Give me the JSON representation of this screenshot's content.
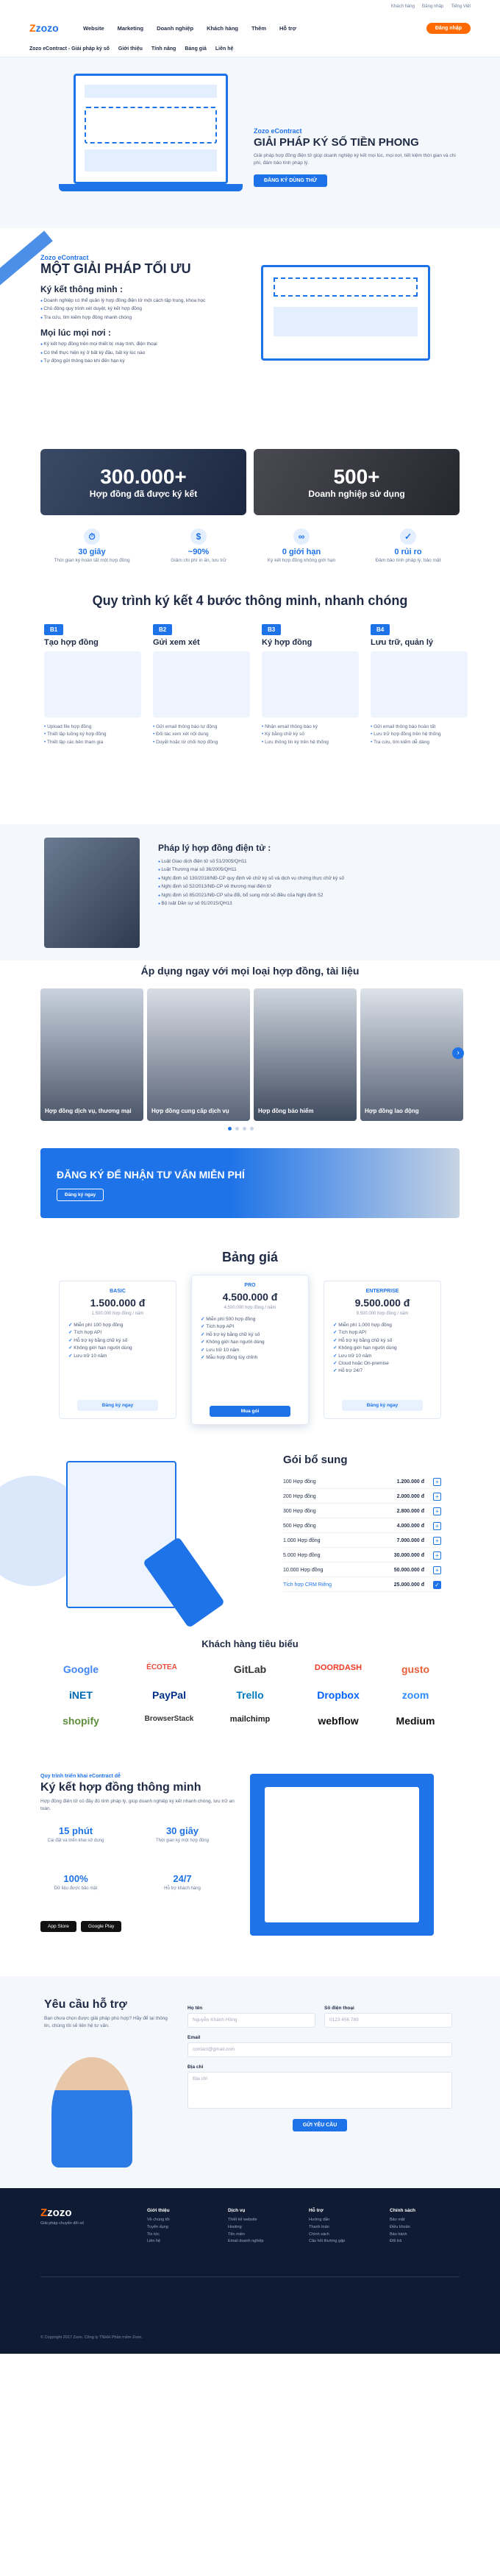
{
  "topbar": {
    "links": [
      "Khách hàng",
      "Đăng nhập",
      "Tiếng Việt"
    ]
  },
  "header": {
    "logo": "zozo",
    "menu": [
      "Website",
      "Marketing",
      "Doanh nghiệp",
      "Khách hàng",
      "Thêm",
      "Hỗ trợ"
    ],
    "cta": "Đăng nhập"
  },
  "subnav": [
    "Zozo eContract - Giải pháp ký số",
    "Giới thiệu",
    "Tính năng",
    "Bảng giá",
    "Liên hệ"
  ],
  "hero": {
    "eyebrow": "Zozo eContract",
    "title": "GIẢI PHÁP KÝ SỐ TIỀN PHONG",
    "desc": "Giải pháp hợp đồng điện tử giúp doanh nghiệp ký kết mọi lúc, mọi nơi, tiết kiệm thời gian và chi phí, đảm bảo tính pháp lý.",
    "button": "Đăng ký dùng thử"
  },
  "solution": {
    "eyebrow": "Zozo eContract",
    "title": "MỘT GIẢI PHÁP TỐI ƯU",
    "items": [
      {
        "title": "Ký kết thông minh :",
        "bullets": [
          "Doanh nghiệp có thể quản lý hợp đồng điện tử một cách tập trung, khoa học",
          "Chủ động quy trình xét duyệt, ký kết hợp đồng",
          "Tra cứu, tìm kiếm hợp đồng nhanh chóng"
        ]
      },
      {
        "title": "Mọi lúc mọi nơi :",
        "bullets": [
          "Ký kết hợp đồng trên mọi thiết bị: máy tính, điện thoại",
          "Có thể thực hiện ký ở bất kỳ đâu, bất kỳ lúc nào",
          "Tự động gửi thông báo khi đến hạn ký"
        ]
      }
    ]
  },
  "stats": [
    {
      "value": "300.000+",
      "label": "Hợp đồng đã được ký kết"
    },
    {
      "value": "500+",
      "label": "Doanh nghiệp sử dụng"
    }
  ],
  "features": [
    {
      "value": "30 giây",
      "desc": "Thời gian ký hoàn tất một hợp đồng"
    },
    {
      "value": "~90%",
      "desc": "Giảm chi phí in ấn, lưu trữ"
    },
    {
      "value": "0 giới hạn",
      "desc": "Ký kết hợp đồng không giới hạn"
    },
    {
      "value": "0 rủi ro",
      "desc": "Đảm bảo tính pháp lý, bảo mật"
    }
  ],
  "process": {
    "title": "Quy trình ký kết 4 bước thông minh, nhanh chóng",
    "steps": [
      {
        "badge": "B1",
        "title": "Tạo hợp đồng",
        "bullets": [
          "Upload file hợp đồng",
          "Thiết lập luồng ký hợp đồng",
          "Thiết lập các bên tham gia"
        ]
      },
      {
        "badge": "B2",
        "title": "Gửi xem xét",
        "bullets": [
          "Gửi email thông báo tự động",
          "Đối tác xem xét nội dung",
          "Duyệt hoặc từ chối hợp đồng"
        ]
      },
      {
        "badge": "B3",
        "title": "Ký hợp đồng",
        "bullets": [
          "Nhận email thông báo ký",
          "Ký bằng chữ ký số",
          "Lưu thông tin ký trên hệ thống"
        ]
      },
      {
        "badge": "B4",
        "title": "Lưu trữ, quản lý",
        "bullets": [
          "Gửi email thông báo hoàn tất",
          "Lưu trữ hợp đồng trên hệ thống",
          "Tra cứu, tìm kiếm dễ dàng"
        ]
      }
    ]
  },
  "legal": {
    "title": "Pháp lý hợp đồng điện tử :",
    "bullets": [
      "Luật Giao dịch điện tử số 51/2005/QH11",
      "Luật Thương mại số 36/2005/QH11",
      "Nghị định số 130/2018/NĐ-CP quy định về chữ ký số và dịch vụ chứng thực chữ ký số",
      "Nghị định số 52/2013/NĐ-CP về thương mại điện tử",
      "Nghị định số 85/2021/NĐ-CP sửa đổi, bổ sung một số điều của Nghị định 52",
      "Bộ luật Dân sự số 91/2015/QH13"
    ]
  },
  "apply": {
    "title": "Áp dụng ngay với mọi loại hợp đồng, tài liệu",
    "cards": [
      "Hợp đồng dịch vụ, thương mại",
      "Hợp đồng cung cấp dịch vụ",
      "Hợp đồng bảo hiểm",
      "Hợp đồng lao động"
    ]
  },
  "banner": {
    "title": "ĐĂNG KÝ ĐỂ NHẬN TƯ VẤN MIỄN PHÍ",
    "button": "Đăng ký ngay"
  },
  "pricing": {
    "title": "Bảng giá",
    "plans": [
      {
        "name": "BASIC",
        "price": "1.500.000 đ",
        "sub": "1.500.000 hợp đồng / năm",
        "features": [
          "Miễn phí 100 hợp đồng",
          "Tích hợp API",
          "Hỗ trợ ký bằng chữ ký số",
          "Không giới hạn người dùng",
          "Lưu trữ 10 năm"
        ],
        "button": "Đăng ký ngay"
      },
      {
        "name": "PRO",
        "price": "4.500.000 đ",
        "sub": "4.500.000 hợp đồng / năm",
        "features": [
          "Miễn phí 500 hợp đồng",
          "Tích hợp API",
          "Hỗ trợ ký bằng chữ ký số",
          "Không giới hạn người dùng",
          "Lưu trữ 10 năm",
          "Mẫu hợp đồng tùy chỉnh"
        ],
        "button": "Mua gói"
      },
      {
        "name": "ENTERPRISE",
        "price": "9.500.000 đ",
        "sub": "9.500.000 hợp đồng / năm",
        "features": [
          "Miễn phí 1.000 hợp đồng",
          "Tích hợp API",
          "Hỗ trợ ký bằng chữ ký số",
          "Không giới hạn người dùng",
          "Lưu trữ 10 năm",
          "Cloud hoặc On-premise",
          "Hỗ trợ 24/7"
        ],
        "button": "Đăng ký ngay"
      }
    ]
  },
  "addon": {
    "title": "Gói bổ sung",
    "rows": [
      {
        "label": "100 Hợp đồng",
        "price": "1.200.000 đ"
      },
      {
        "label": "200 Hợp đồng",
        "price": "2.000.000 đ"
      },
      {
        "label": "300 Hợp đồng",
        "price": "2.800.000 đ"
      },
      {
        "label": "500 Hợp đồng",
        "price": "4.000.000 đ"
      },
      {
        "label": "1.000 Hợp đồng",
        "price": "7.000.000 đ"
      },
      {
        "label": "5.000 Hợp đồng",
        "price": "30.000.000 đ"
      },
      {
        "label": "10.000 Hợp đồng",
        "price": "50.000.000 đ"
      },
      {
        "label": "Tích hợp CRM Riêng",
        "price": "25.000.000 đ"
      }
    ]
  },
  "clients": {
    "title": "Khách hàng tiêu biểu",
    "logos": [
      "Google",
      "ÉCOTEA",
      "GitLab",
      "DOORDASH",
      "gusto",
      "iNET",
      "PayPal",
      "Trello",
      "Dropbox",
      "zoom",
      "shopify",
      "BrowserStack",
      "mailchimp",
      "webflow",
      "Medium"
    ]
  },
  "app": {
    "eyebrow": "Quy trình triển khai eContract dễ",
    "title": "Ký kết hợp đồng thông minh",
    "desc": "Hợp đồng điện tử có đầy đủ tính pháp lý, giúp doanh nghiệp ký kết nhanh chóng, lưu trữ an toàn.",
    "stats": [
      {
        "value": "15 phút",
        "desc": "Cài đặt và triển khai sử dụng"
      },
      {
        "value": "30 giây",
        "desc": "Thời gian ký một hợp đồng"
      },
      {
        "value": "100%",
        "desc": "Dữ liệu được bảo mật"
      },
      {
        "value": "24/7",
        "desc": "Hỗ trợ khách hàng"
      }
    ],
    "stores": [
      "App Store",
      "Google Play"
    ]
  },
  "support": {
    "title": "Yêu cầu hỗ trợ",
    "desc": "Bạn chưa chọn được giải pháp phù hợp? Hãy để lại thông tin, chúng tôi sẽ liên hệ tư vấn.",
    "fields": [
      {
        "label": "Họ tên",
        "ph": "Nguyễn Khánh Hồng"
      },
      {
        "label": "Số điện thoại",
        "ph": "0123 456 789"
      },
      {
        "label": "Email",
        "ph": "contact@gmail.com"
      },
      {
        "label": "Địa chỉ",
        "ph": "Địa chỉ"
      }
    ],
    "button": "Gửi yêu cầu"
  },
  "footer": {
    "logo": "zozo",
    "tagline": "Giải pháp chuyển đổi số",
    "cols": [
      {
        "title": "Giới thiệu",
        "items": [
          "Về chúng tôi",
          "Tuyển dụng",
          "Tin tức",
          "Liên hệ"
        ]
      },
      {
        "title": "Dịch vụ",
        "items": [
          "Thiết kế website",
          "Hosting",
          "Tên miền",
          "Email doanh nghiệp"
        ]
      },
      {
        "title": "Hỗ trợ",
        "items": [
          "Hướng dẫn",
          "Thanh toán",
          "Chính sách",
          "Câu hỏi thường gặp"
        ]
      },
      {
        "title": "Chính sách",
        "items": [
          "Bảo mật",
          "Điều khoản",
          "Bảo hành",
          "Đổi trả"
        ]
      }
    ],
    "copyright": "© Copyright 2017 Zozo. Công ty TNHH Phần mềm Zozo."
  }
}
